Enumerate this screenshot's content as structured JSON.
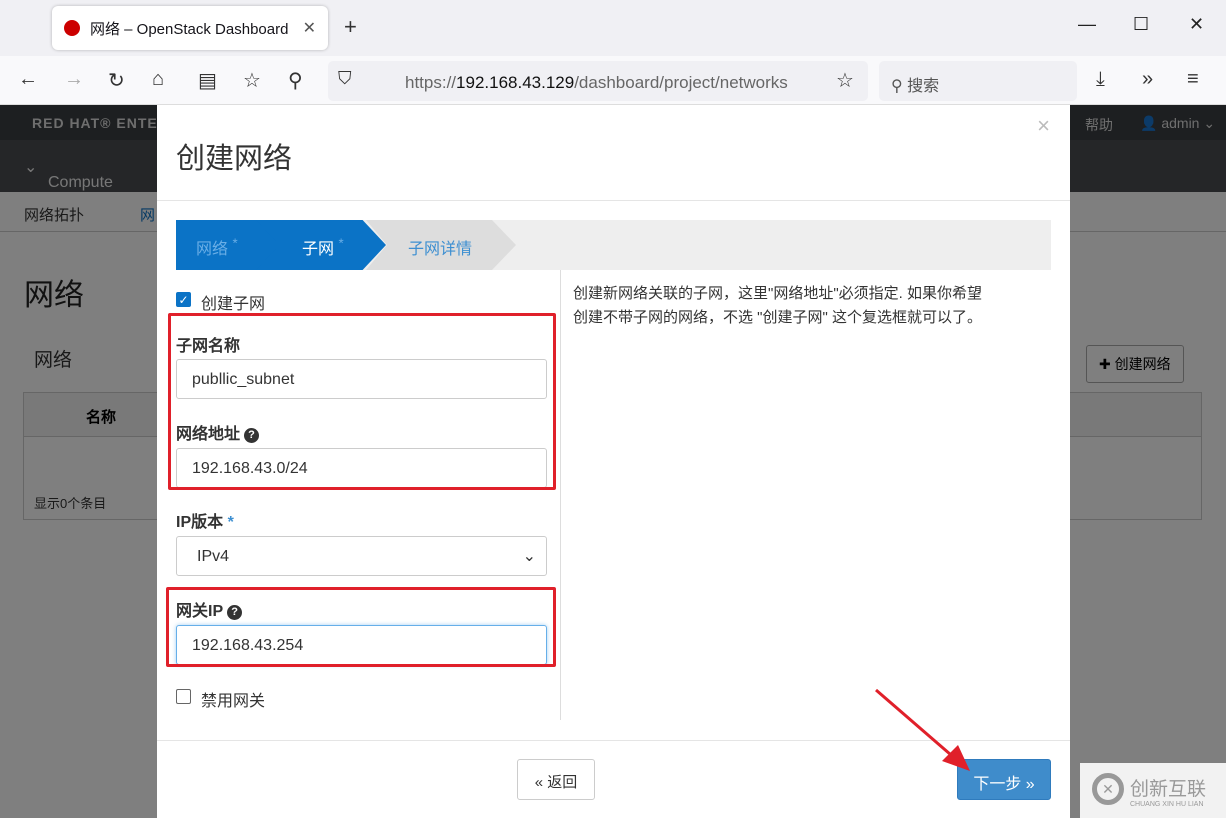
{
  "browser": {
    "tab_title": "网络 – OpenStack Dashboard",
    "url_host": "192.168.43.129",
    "url_prefix": "https://",
    "url_path": "/dashboard/project/networks",
    "search_placeholder": "搜索"
  },
  "page": {
    "brand": "RED HAT® ENTER",
    "help": "帮助",
    "user": "admin",
    "nav_compute": "Compute",
    "subnav": [
      "网络拓扑",
      "网"
    ],
    "title": "网络",
    "section": "网络",
    "create_button": "创建网络",
    "col_name": "名称",
    "footer": "显示0个条目"
  },
  "modal": {
    "title": "创建网络",
    "close": "×",
    "steps": [
      {
        "label": "网络",
        "req": "*"
      },
      {
        "label": "子网",
        "req": "*"
      },
      {
        "label": "子网详情"
      }
    ],
    "create_subnet": {
      "label": "创建子网",
      "checked": true
    },
    "subnet_name": {
      "label": "子网名称",
      "value": "publlic_subnet"
    },
    "network_address": {
      "label": "网络地址",
      "value": "192.168.43.0/24"
    },
    "ip_version": {
      "label": "IP版本",
      "req": "*",
      "value": "IPv4"
    },
    "gateway_ip": {
      "label": "网关IP",
      "value": "192.168.43.254"
    },
    "disable_gateway": {
      "label": "禁用网关",
      "checked": false
    },
    "help_text": "创建新网络关联的子网，这里\"网络地址\"必须指定. 如果你希望创建不带子网的网络，不选 \"创建子网\" 这个复选框就可以了。",
    "back": "« 返回",
    "next": "下一步 »"
  },
  "watermark": {
    "text": "创新互联",
    "sub": "CHUANG XIN HU LIAN"
  }
}
